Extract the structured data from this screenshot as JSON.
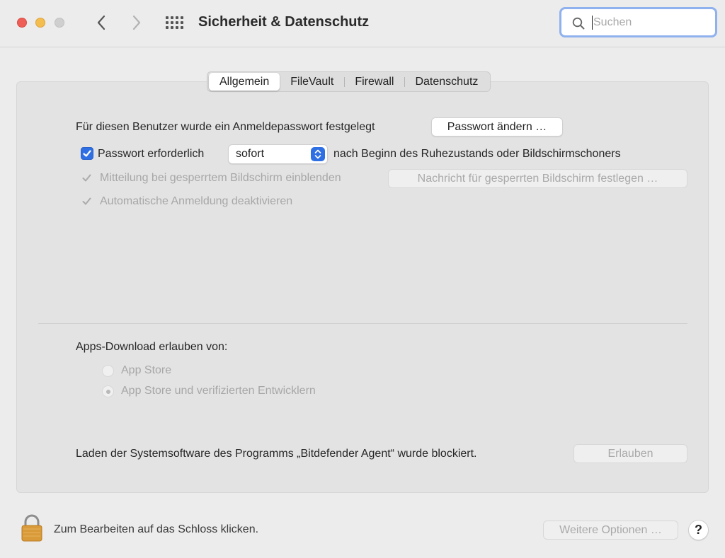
{
  "window": {
    "title": "Sicherheit & Datenschutz",
    "search": {
      "placeholder": "Suchen",
      "value": ""
    }
  },
  "tabs": [
    {
      "label": "Allgemein",
      "selected": true
    },
    {
      "label": "FileVault",
      "selected": false
    },
    {
      "label": "Firewall",
      "selected": false
    },
    {
      "label": "Datenschutz",
      "selected": false
    }
  ],
  "general": {
    "password_text": "Für diesen Benutzer wurde ein Anmeldepasswort festgelegt",
    "change_password_button": "Passwort ändern …",
    "require_password": {
      "label": "Passwort erforderlich",
      "checked": true
    },
    "require_password_delay": "sofort",
    "require_password_suffix": "nach Beginn des Ruhezustands oder Bildschirmschoners",
    "lock_message": {
      "label": "Mitteilung bei gesperrtem Bildschirm einblenden",
      "checked": true,
      "enabled": false
    },
    "lock_message_button": "Nachricht für gesperrten Bildschirm festlegen …",
    "auto_login": {
      "label": "Automatische Anmeldung deaktivieren",
      "checked": true,
      "enabled": false
    }
  },
  "downloads": {
    "heading": "Apps-Download erlauben von:",
    "options": [
      {
        "label": "App Store",
        "selected": false
      },
      {
        "label": "App Store und verifizierten Entwicklern",
        "selected": true
      }
    ]
  },
  "blocked": {
    "text": "Laden der Systemsoftware des Programms „Bitdefender Agent“ wurde blockiert.",
    "allow_button": "Erlauben"
  },
  "footer": {
    "lock_text": "Zum Bearbeiten auf das Schloss klicken.",
    "more_options_button": "Weitere Optionen …",
    "help_label": "?"
  },
  "colors": {
    "accent": "#2f6fe4",
    "search_focus_ring": "#8fb1ee",
    "close": "#ee5e56",
    "minimize": "#f4bd4f",
    "lock": "#d99a3a"
  },
  "icons": {
    "back": "chevron-left-icon",
    "forward": "chevron-right-icon",
    "show_all": "grid-icon",
    "search": "magnifier-icon",
    "lock": "padlock-icon"
  }
}
